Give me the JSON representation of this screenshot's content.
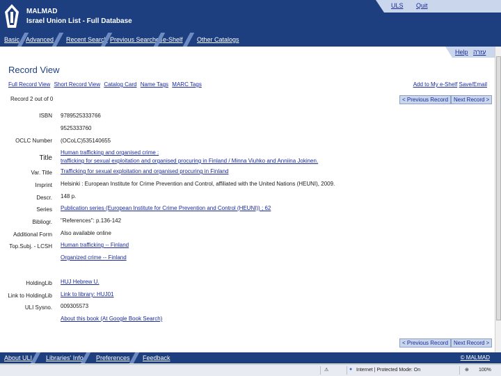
{
  "header": {
    "title_line1": "MALMAD",
    "title_line2": "Israel Union List - Full Database",
    "top_links": [
      "ULS",
      "Quit"
    ]
  },
  "nav": [
    "Basic",
    "Advanced",
    "Recent Search",
    "Previous Searches",
    "e-Shelf",
    "Other Catalogs"
  ],
  "help": [
    "Help",
    "עזרה"
  ],
  "page_title": "Record View",
  "view_tabs": [
    "Full Record View",
    "Short Record View",
    "Catalog Card",
    "Name Tags",
    "MARC Tags"
  ],
  "right_actions": [
    "Add to My e-Shelf",
    "Save/Email"
  ],
  "record_count": "Record 2 out of 0",
  "buttons": {
    "prev": "< Previous Record",
    "next": "Next Record >"
  },
  "record": {
    "isbn_label": "ISBN",
    "isbn_1": "9789525333766",
    "isbn_2": "9525333760",
    "oclc_label": "OCLC Number",
    "oclc": "(OCoLC)535140655",
    "title_label": "Title",
    "title_1": "Human trafficking and organised crime :",
    "title_2": "trafficking for sexual exploitation and organised procuring in Finland / Minna Viuhko and Anniina Jokinen.",
    "vartitle_label": "Var. Title",
    "vartitle": "Trafficking for sexual exploitation and organised procuring in Finland",
    "imprint_label": "Imprint",
    "imprint": "Helsinki : European Institute for Crime Prevention and Control, affiliated with the United Nations (HEUNI), 2009.",
    "descr_label": "Descr.",
    "descr": "148 p.",
    "series_label": "Series",
    "series": "Publication series (European Institute for Crime Prevention and Control (HEUNI)) ; 62",
    "bibliogr_label": "Bibliogr.",
    "bibliogr": "\"References\": p.136-142",
    "addform_label": "Additional Form",
    "addform": "Also available online",
    "topsubj_label": "Top.Subj. - LCSH",
    "topsubj_1": "Human trafficking -- Finland",
    "topsubj_2": "Organized crime -- Finland",
    "holdinglib_label": "HoldingLib",
    "holdinglib": "HUJ Hebrew U.",
    "link_label": "Link to HoldingLib",
    "link": "Link to library: HUJ01",
    "uli_label": "ULI Sysno.",
    "uli": "009305573",
    "about": "About this book (At Google Book Search)"
  },
  "footer": {
    "items": [
      "About ULI",
      "Libraries' Info",
      "Preferences",
      "Feedback"
    ],
    "copyright": "© MALMAD"
  },
  "statusbar": {
    "zone": "Internet | Protected Mode: On",
    "zoom": "100%"
  }
}
